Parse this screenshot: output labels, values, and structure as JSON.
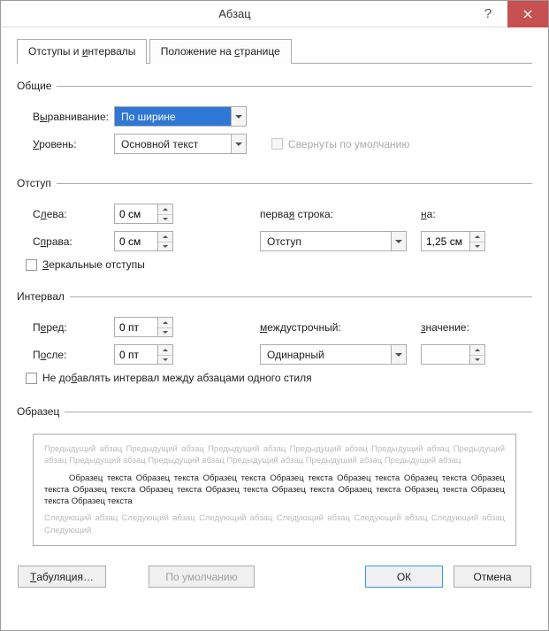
{
  "window": {
    "title": "Абзац",
    "help_tooltip": "?",
    "close_tooltip": "Закрыть"
  },
  "tabs": {
    "indents": "Отступы и интервалы",
    "position": "Положение на странице",
    "indents_hotkey": "и",
    "position_hotkey": "с"
  },
  "sections": {
    "general": "Общие",
    "indent": "Отступ",
    "spacing": "Интервал",
    "preview": "Образец"
  },
  "general": {
    "alignment_label": "Выравнивание:",
    "alignment_value": "По ширине",
    "outline_label": "Уровень:",
    "outline_value": "Основной текст",
    "collapsed_label": "Свернуты по умолчанию",
    "collapsed_disabled": true
  },
  "indent": {
    "left_label": "Слева:",
    "left_value": "0 см",
    "right_label": "Справа:",
    "right_value": "0 см",
    "special_label": "первая строка:",
    "special_value": "Отступ",
    "by_label": "на:",
    "by_value": "1,25 см",
    "mirror_label": "Зеркальные отступы"
  },
  "spacing": {
    "before_label": "Перед:",
    "before_value": "0 пт",
    "after_label": "После:",
    "after_value": "0 пт",
    "line_label": "междустрочный:",
    "line_value": "Одинарный",
    "at_label": "значение:",
    "at_value": "",
    "no_space_label": "Не добавлять интервал между абзацами одного стиля"
  },
  "preview": {
    "prev_para": "Предыдущий абзац Предыдущий абзац Предыдущий абзац Предыдущий абзац Предыдущий абзац Предыдущий абзац Предыдущий абзац Предыдущий абзац Предыдущий абзац Предыдущий абзац Предыдущий абзац",
    "sample": "Образец текста Образец текста Образец текста Образец текста Образец текста Образец текста Образец текста Образец текста Образец текста Образец текста Образец текста Образец текста Образец текста Образец текста Образец текста",
    "next_para": "Следующий абзац Следующий абзац Следующий абзац Следующий абзац Следующий абзац Следующий абзац Следующий"
  },
  "footer": {
    "tabs_btn": "Табуляция…",
    "default_btn": "По умолчанию",
    "ok_btn": "ОК",
    "cancel_btn": "Отмена"
  }
}
